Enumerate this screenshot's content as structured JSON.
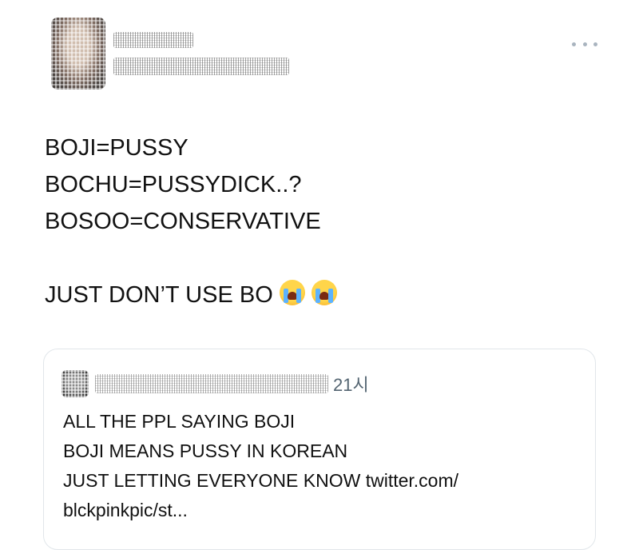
{
  "tweet": {
    "more_icon": "more-horizontal-icon",
    "text_lines": [
      "BOJI=PUSSY",
      "BOCHU=PUSSYDICK..?",
      "BOSOO=CONSERVATIVE"
    ],
    "closing_line": "JUST DON’T USE BO",
    "emoji": [
      "😭",
      "😭"
    ]
  },
  "quote": {
    "time": "21시",
    "text_lines": [
      "ALL THE PPL SAYING BOJI",
      "BOJI MEANS PUSSY IN KOREAN",
      "JUST LETTING EVERYONE KNOW twitter.com/",
      "blckpinkpic/st..."
    ]
  },
  "colors": {
    "text": "#111111",
    "muted": "#536471",
    "card_border": "#e1e6ea",
    "more_dots": "#a9b4bf"
  }
}
